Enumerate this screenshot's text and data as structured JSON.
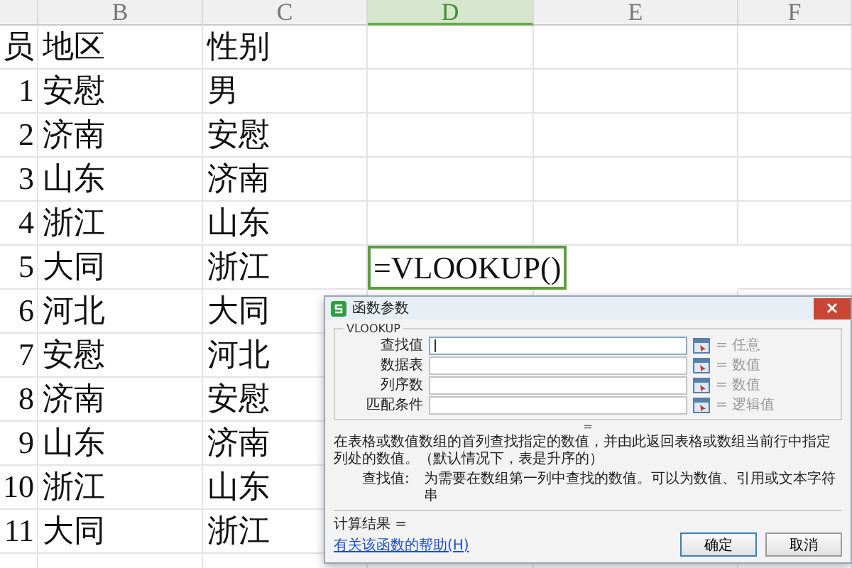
{
  "columns": [
    {
      "label": "B",
      "selected": false
    },
    {
      "label": "C",
      "selected": false
    },
    {
      "label": "D",
      "selected": true
    },
    {
      "label": "E",
      "selected": false
    },
    {
      "label": "F",
      "selected": false
    }
  ],
  "rows": [
    {
      "cells": [
        "员",
        "地区",
        "性别"
      ]
    },
    {
      "cells": [
        "1",
        "安慰",
        "男"
      ]
    },
    {
      "cells": [
        "2",
        "济南",
        "安慰"
      ]
    },
    {
      "cells": [
        "3",
        "山东",
        "济南"
      ]
    },
    {
      "cells": [
        "4",
        "浙江",
        "山东"
      ]
    },
    {
      "cells": [
        "5",
        "大同",
        "浙江",
        "=VLOOKUP()"
      ]
    },
    {
      "cells": [
        "6",
        "河北",
        "大同"
      ]
    },
    {
      "cells": [
        "7",
        "安慰",
        "河北"
      ]
    },
    {
      "cells": [
        "8",
        "济南",
        "安慰"
      ]
    },
    {
      "cells": [
        "9",
        "山东",
        "济南"
      ]
    },
    {
      "cells": [
        "10",
        "浙江",
        "山东"
      ]
    },
    {
      "cells": [
        "11",
        "大同",
        "浙江"
      ]
    }
  ],
  "dialog": {
    "title": "函数参数",
    "function_name": "VLOOKUP",
    "arguments": [
      {
        "label": "查找值",
        "hint": "= 任意",
        "focused": true
      },
      {
        "label": "数据表",
        "hint": "= 数值",
        "focused": false
      },
      {
        "label": "列序数",
        "hint": "= 数值",
        "focused": false
      },
      {
        "label": "匹配条件",
        "hint": "= 逻辑值",
        "focused": false
      }
    ],
    "equals": "=",
    "description": "在表格或数值数组的首列查找指定的数值，并由此返回表格或数组当前行中指定列处的数值。（默认情况下，表是升序的）",
    "argument_help_label": "查找值:",
    "argument_help": "为需要在数组第一列中查找的数值。可以为数值、引用或文本字符串",
    "result_label": "计算结果 =",
    "help_link": "有关该函数的帮助(H)",
    "buttons": [
      {
        "label": "确定",
        "default": true
      },
      {
        "label": "取消",
        "default": false
      }
    ]
  }
}
